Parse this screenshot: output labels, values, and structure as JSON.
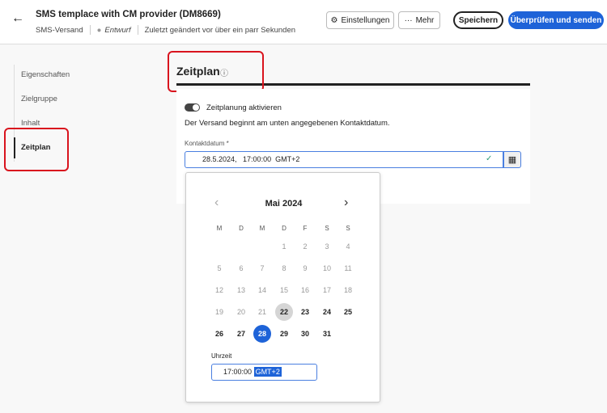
{
  "header": {
    "title": "SMS templace with CM provider (DM8669)",
    "channel": "SMS-Versand",
    "status": "Entwurf",
    "modified": "Zuletzt geändert vor über ein parr Sekunden",
    "settings_label": "Einstellungen",
    "more_label": "Mehr",
    "save_label": "Speichern",
    "send_label": "Überprüfen und senden"
  },
  "sidebar": {
    "items": [
      {
        "label": "Eigenschaften"
      },
      {
        "label": "Zielgruppe"
      },
      {
        "label": "Inhalt"
      },
      {
        "label": "Zeitplan"
      }
    ]
  },
  "main": {
    "title": "Zeitplan",
    "toggle_label": "Zeitplanung aktivieren",
    "toggle_on": true,
    "description": "Der Versand beginnt am unten angegebenen Kontaktdatum.",
    "date_label": "Kontaktdatum",
    "required_mark": "*",
    "date_value": "28.5.2024,   17:00:00  GMT+2"
  },
  "calendar": {
    "month": "Mai 2024",
    "weekdays": [
      "M",
      "D",
      "M",
      "D",
      "F",
      "S",
      "S"
    ],
    "first_weekday_index": 3,
    "days_in_month": 31,
    "today": 22,
    "selected": 28,
    "time_label": "Uhrzeit",
    "time_value": "17:00:00",
    "timezone": "GMT+2"
  },
  "colors": {
    "accent": "#1e63d8",
    "annotation": "#d9141e"
  }
}
